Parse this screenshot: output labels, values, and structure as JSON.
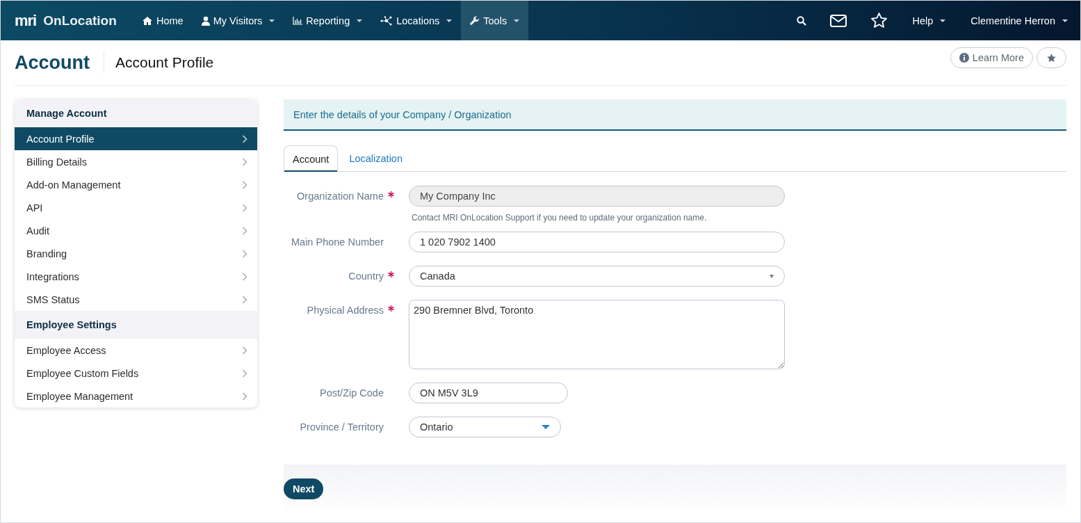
{
  "brand": {
    "logo": "mri",
    "name": "OnLocation"
  },
  "nav": [
    {
      "label": "Home",
      "has_menu": false,
      "selected": false
    },
    {
      "label": "My Visitors",
      "has_menu": true,
      "selected": false
    },
    {
      "label": "Reporting",
      "has_menu": true,
      "selected": false
    },
    {
      "label": "Locations",
      "has_menu": true,
      "selected": false
    },
    {
      "label": "Tools",
      "has_menu": true,
      "selected": true
    }
  ],
  "nav_right": [
    {
      "label": "Help"
    },
    {
      "label": "Clementine Herron"
    }
  ],
  "page": {
    "title": "Account",
    "subtitle": "Account Profile",
    "learn_more": "Learn More"
  },
  "sidebar": [
    {
      "heading": "Manage Account",
      "items": [
        {
          "label": "Account Profile",
          "selected": true
        },
        {
          "label": "Billing Details",
          "selected": false
        },
        {
          "label": "Add-on Management",
          "selected": false
        },
        {
          "label": "API",
          "selected": false
        },
        {
          "label": "Audit",
          "selected": false
        },
        {
          "label": "Branding",
          "selected": false
        },
        {
          "label": "Integrations",
          "selected": false
        },
        {
          "label": "SMS Status",
          "selected": false
        }
      ]
    },
    {
      "heading": "Employee Settings",
      "items": [
        {
          "label": "Employee Access",
          "selected": false
        },
        {
          "label": "Employee Custom Fields",
          "selected": false
        },
        {
          "label": "Employee Management",
          "selected": false
        }
      ]
    }
  ],
  "banner": "Enter the details of your Company / Organization",
  "tabs": [
    {
      "label": "Account",
      "selected": true
    },
    {
      "label": "Localization",
      "selected": false
    }
  ],
  "fields": [
    {
      "label": "Organization Name",
      "required": true,
      "kind": "input",
      "value": "My Company Inc",
      "disabled": true,
      "hint": "Contact MRI OnLocation Support if you need to update your organization name."
    },
    {
      "label": "Main Phone Number",
      "required": false,
      "kind": "input",
      "value": "1 020 7902 1400",
      "disabled": false
    },
    {
      "label": "Country",
      "required": true,
      "kind": "select",
      "value": "Canada",
      "disabled": false
    },
    {
      "label": "Physical Address",
      "required": true,
      "kind": "textarea",
      "value": "290 Bremner Blvd, Toronto",
      "disabled": false
    },
    {
      "label": "Post/Zip Code",
      "required": false,
      "kind": "short_input",
      "value": "ON M5V 3L9",
      "disabled": false
    },
    {
      "label": "Province / Territory",
      "required": false,
      "kind": "combo",
      "value": "Ontario",
      "disabled": false
    }
  ],
  "next_button": "Next"
}
